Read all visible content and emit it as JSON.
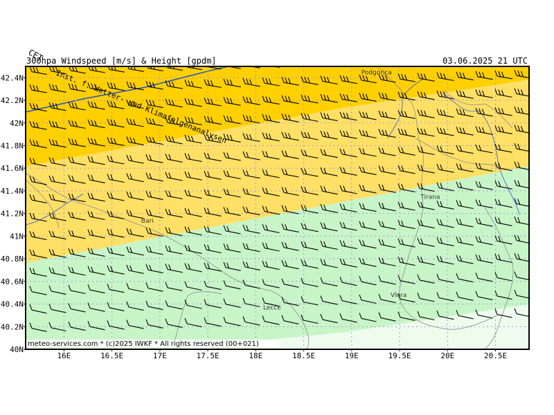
{
  "header": {
    "title": "300hpa Windspeed [m/s] & Height [gpdm]",
    "datetime": "03.06.2025 21 UTC",
    "corner_label": "CET"
  },
  "map": {
    "lat_range": [
      40.0,
      42.5
    ],
    "lon_range": [
      15.6,
      20.85
    ],
    "y_axis_labels": [
      "42.4N",
      "42.2N",
      "42N",
      "41.8N",
      "41.6N",
      "41.4N",
      "41.2N",
      "41N",
      "40.8N",
      "40.6N",
      "40.4N",
      "40.2N",
      "40N"
    ],
    "x_axis_labels": [
      "16E",
      "16.5E",
      "17E",
      "17.5E",
      "18E",
      "18.5E",
      "19E",
      "19.5E",
      "20E",
      "20.5E"
    ],
    "grid": true,
    "cities": [
      {
        "name": "Podgorica",
        "lon": 19.26,
        "lat": 42.43
      },
      {
        "name": "Tirana",
        "lon": 19.82,
        "lat": 41.33
      },
      {
        "name": "Bari",
        "lon": 16.87,
        "lat": 41.12
      },
      {
        "name": "Lecce",
        "lon": 18.17,
        "lat": 40.35
      },
      {
        "name": "Vlora",
        "lon": 19.49,
        "lat": 40.46
      }
    ],
    "contour_label": "Inst. f. Wetter- und Klimafolgenanalysen",
    "wind_speed_bands": [
      {
        "range": "highest",
        "color": "#ffd000"
      },
      {
        "range": "high",
        "color": "#ffe066"
      },
      {
        "range": "moderate",
        "color": "#c8f5c8"
      },
      {
        "range": "low",
        "color": "#e6fbe6"
      }
    ]
  },
  "footer": {
    "credit": "meteo-services.com * (c)2025 IWKF * All rights reserved (00+021)"
  }
}
